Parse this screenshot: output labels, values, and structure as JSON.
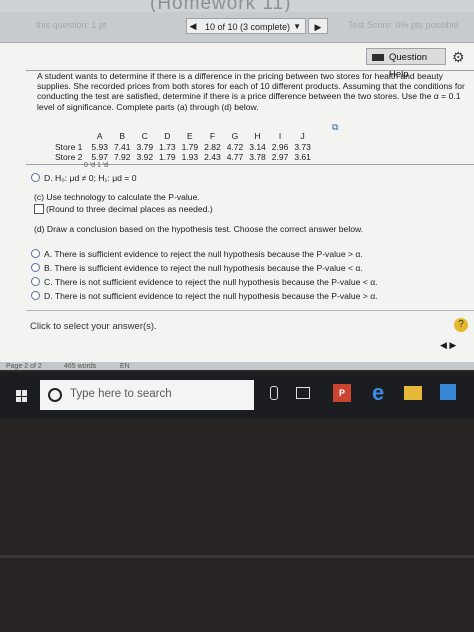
{
  "window": {
    "title_partial": "(Homework 11)"
  },
  "toolbar": {
    "left_ghost": "this question: 1 pt",
    "right_ghost": "Test Score: 0% pts possible",
    "progress_label": "10 of 10 (3 complete)",
    "prev_symbol": "◀",
    "next_symbol": "▶",
    "dropdown_symbol": "▼",
    "question_help": "Question Help",
    "gear_symbol": "⚙"
  },
  "problem": {
    "statement": "A student wants to determine if there is a difference in the pricing between two stores for health and beauty supplies. She recorded prices from both stores for each of 10 different products. Assuming that the conditions for conducting the test are satisfied, determine if there is a price difference between the two stores. Use the α = 0.1 level of significance. Complete parts (a) through (d) below.",
    "copy_icon": "⧉"
  },
  "table": {
    "headers": [
      "",
      "A",
      "B",
      "C",
      "D",
      "E",
      "F",
      "G",
      "H",
      "I",
      "J"
    ],
    "rows": [
      {
        "label": "Store 1",
        "values": [
          "5.93",
          "7.41",
          "3.79",
          "1.73",
          "1.79",
          "2.82",
          "4.72",
          "3.14",
          "2.96",
          "3.73"
        ]
      },
      {
        "label": "Store 2",
        "values": [
          "5.97",
          "7.92",
          "3.92",
          "1.79",
          "1.93",
          "2.43",
          "4.77",
          "3.78",
          "2.97",
          "3.61"
        ]
      }
    ]
  },
  "cut_fragment": "0   ′d       1   ′d",
  "option_d_hyp": "D.  H₀: μd ≠ 0; H₁: μd = 0",
  "part_c": {
    "text": "(c) Use technology to calculate the P-value.",
    "note": "(Round to three decimal places as needed.)"
  },
  "part_d": {
    "text": "(d) Draw a conclusion based on the hypothesis test. Choose the correct answer below.",
    "choices": [
      "A.  There is sufficient evidence to reject the null hypothesis because the P-value > α.",
      "B.  There is sufficient evidence to reject the null hypothesis because the P-value < α.",
      "C.  There is not sufficient evidence to reject the null hypothesis because the P-value < α.",
      "D.  There is not sufficient evidence to reject the null hypothesis because the P-value > α."
    ]
  },
  "footer": {
    "prompt": "Click to select your answer(s).",
    "help": "?",
    "nav_arrows": "◀   ▶"
  },
  "statusbar": {
    "page": "Page 2 of 2",
    "words": "465 words",
    "lang": "EN"
  },
  "taskbar": {
    "search_placeholder": "Type here to search",
    "ppt_label": "P"
  }
}
